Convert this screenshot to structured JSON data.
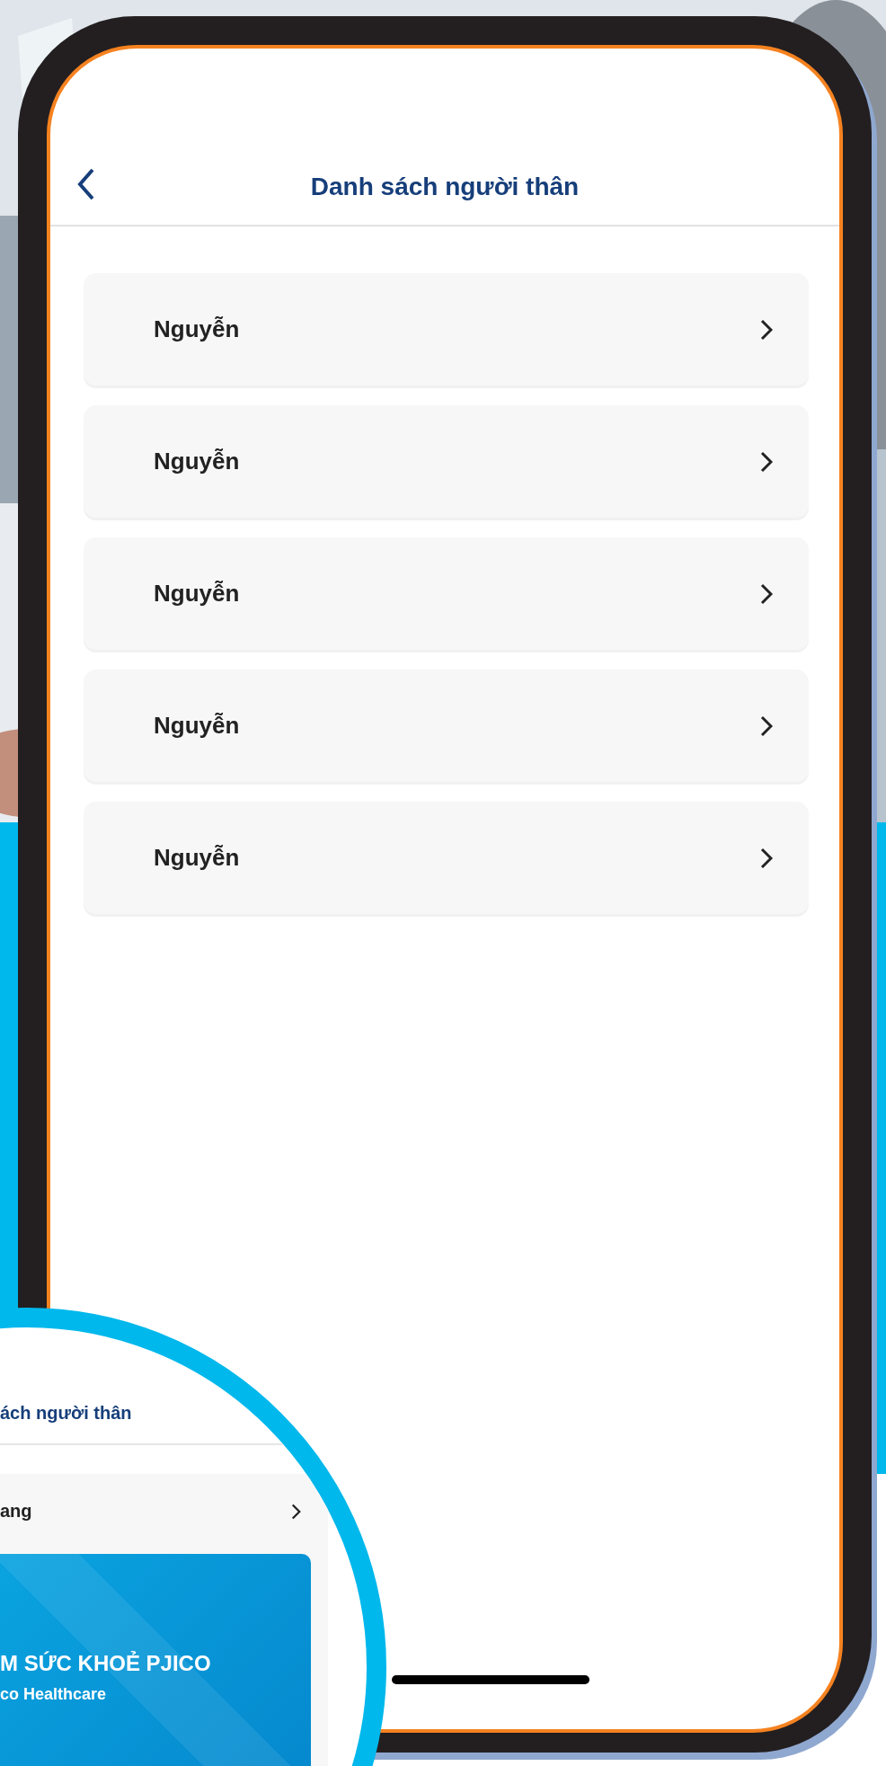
{
  "header": {
    "title": "Danh sách người thân"
  },
  "relatives": [
    {
      "name": "Nguyễn"
    },
    {
      "name": "Nguyễn"
    },
    {
      "name": "Nguyễn"
    },
    {
      "name": "Nguyễn"
    },
    {
      "name": "Nguyễn"
    }
  ],
  "inset": {
    "title": "ách người thân",
    "row_name": "ang",
    "card": {
      "title": "M SỨC KHOẺ PJICO",
      "subtitle": "co Healthcare"
    }
  }
}
